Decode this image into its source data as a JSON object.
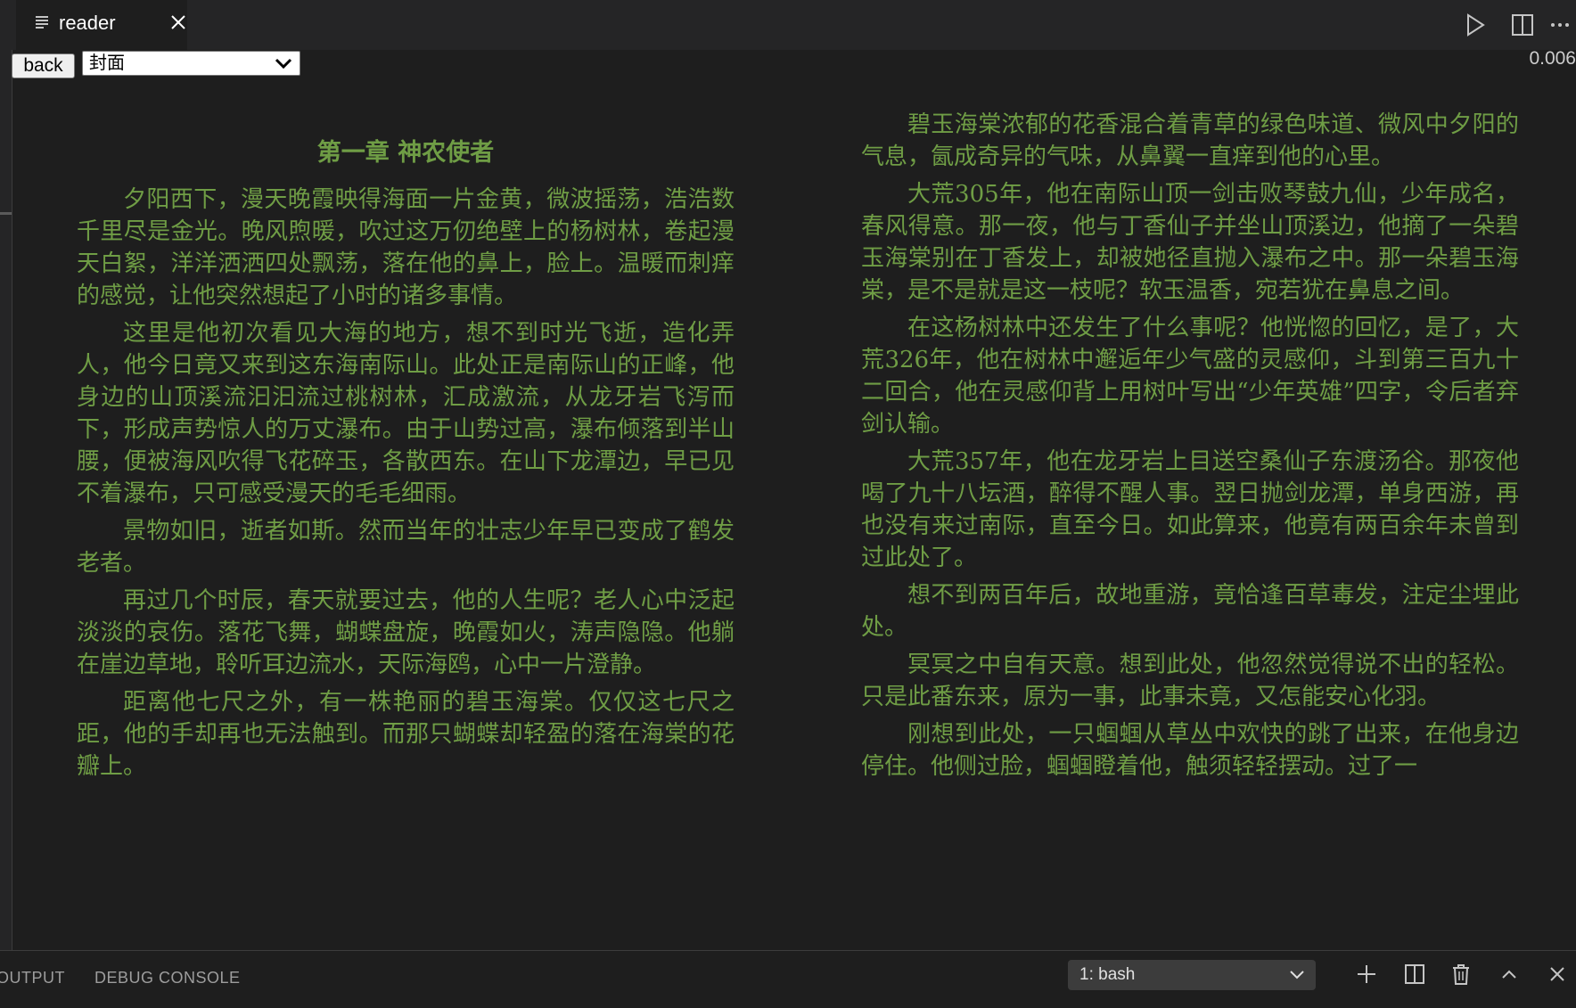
{
  "tab": {
    "title": "reader"
  },
  "controls": {
    "back_label": "back",
    "chapter_selected": "封面",
    "progress": "0.006"
  },
  "content": {
    "chapter_title": "第一章 神农使者",
    "left_paragraphs": [
      "夕阳西下，漫天晚霞映得海面一片金黄，微波摇荡，浩浩数千里尽是金光。晚风煦暖，吹过这万仞绝壁上的杨树林，卷起漫天白絮，洋洋洒洒四处飘荡，落在他的鼻上，脸上。温暖而刺痒的感觉，让他突然想起了小时的诸多事情。",
      "这里是他初次看见大海的地方，想不到时光飞逝，造化弄人，他今日竟又来到这东海南际山。此处正是南际山的正峰，他身边的山顶溪流汩汩流过桃树林，汇成激流，从龙牙岩飞泻而下，形成声势惊人的万丈瀑布。由于山势过高，瀑布倾落到半山腰，便被海风吹得飞花碎玉，各散西东。在山下龙潭边，早已见不着瀑布，只可感受漫天的毛毛细雨。",
      "景物如旧，逝者如斯。然而当年的壮志少年早已变成了鹤发老者。",
      "再过几个时辰，春天就要过去，他的人生呢？老人心中泛起淡淡的哀伤。落花飞舞，蝴蝶盘旋，晚霞如火，涛声隐隐。他躺在崖边草地，聆听耳边流水，天际海鸥，心中一片澄静。",
      "距离他七尺之外，有一株艳丽的碧玉海棠。仅仅这七尺之距，他的手却再也无法触到。而那只蝴蝶却轻盈的落在海棠的花瓣上。"
    ],
    "right_paragraphs": [
      "碧玉海棠浓郁的花香混合着青草的绿色味道、微风中夕阳的气息，氤成奇异的气味，从鼻翼一直痒到他的心里。",
      "大荒305年，他在南际山顶一剑击败琴鼓九仙，少年成名，春风得意。那一夜，他与丁香仙子并坐山顶溪边，他摘了一朵碧玉海棠别在丁香发上，却被她径直抛入瀑布之中。那一朵碧玉海棠，是不是就是这一枝呢？软玉温香，宛若犹在鼻息之间。",
      "在这杨树林中还发生了什么事呢？他恍惚的回忆，是了，大荒326年，他在树林中邂逅年少气盛的灵感仰，斗到第三百九十二回合，他在灵感仰背上用树叶写出“少年英雄”四字，令后者弃剑认输。",
      "大荒357年，他在龙牙岩上目送空桑仙子东渡汤谷。那夜他喝了九十八坛酒，醉得不醒人事。翌日抛剑龙潭，单身西游，再也没有来过南际，直至今日。如此算来，他竟有两百余年未曾到过此处了。",
      "想不到两百年后，故地重游，竟恰逢百草毒发，注定尘埋此处。",
      "冥冥之中自有天意。想到此处，他忽然觉得说不出的轻松。只是此番东来，原为一事，此事未竟，又怎能安心化羽。",
      "刚想到此处，一只蝈蝈从草丛中欢快的跳了出来，在他身边停住。他侧过脸，蝈蝈瞪着他，触须轻轻摆动。过了一"
    ]
  },
  "panel": {
    "tabs": [
      "OUTPUT",
      "DEBUG CONSOLE"
    ],
    "terminal_selected": "1: bash"
  },
  "colors": {
    "text_green": "#6f9d45",
    "editor_bg": "#1e1e1e",
    "tabbar_bg": "#252526"
  },
  "icons": [
    "file-lines-icon",
    "close-icon",
    "run-icon",
    "split-editor-icon",
    "more-actions-icon",
    "chevron-down-icon",
    "plus-icon",
    "split-terminal-icon",
    "trash-icon",
    "chevron-up-icon",
    "close-panel-icon"
  ]
}
